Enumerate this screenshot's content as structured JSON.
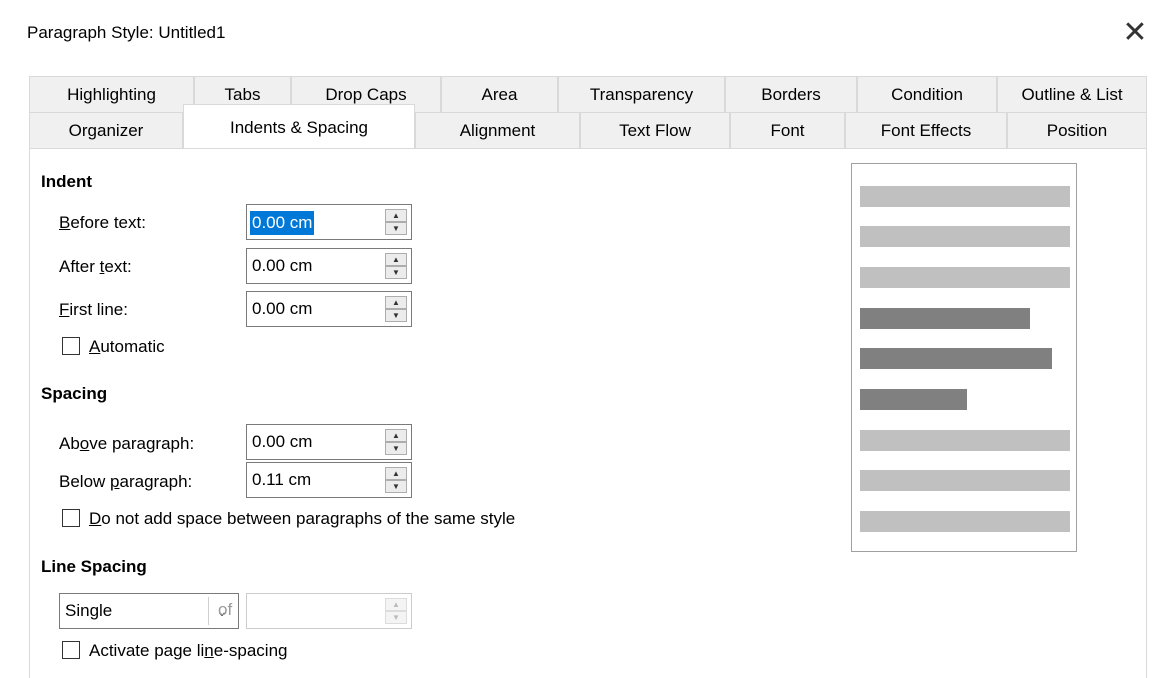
{
  "window": {
    "title": "Paragraph Style: Untitled1"
  },
  "tabs_row1": [
    "Highlighting",
    "Tabs",
    "Drop Caps",
    "Area",
    "Transparency",
    "Borders",
    "Condition",
    "Outline & List"
  ],
  "tabs_row2": [
    "Organizer",
    "Indents & Spacing",
    "Alignment",
    "Text Flow",
    "Font",
    "Font Effects",
    "Position"
  ],
  "active_tab": "Indents & Spacing",
  "indent": {
    "heading": "Indent",
    "before_text": {
      "label_pre": "",
      "label_key": "B",
      "label_post": "efore text:",
      "value": "0.00 cm"
    },
    "after_text": {
      "label_pre": "After ",
      "label_key": "t",
      "label_post": "ext:",
      "value": "0.00 cm"
    },
    "first_line": {
      "label_pre": "",
      "label_key": "F",
      "label_post": "irst line:",
      "value": "0.00 cm"
    },
    "automatic": {
      "label_pre": "",
      "label_key": "A",
      "label_post": "utomatic",
      "checked": false
    }
  },
  "spacing": {
    "heading": "Spacing",
    "above": {
      "label_pre": "Ab",
      "label_key": "o",
      "label_post": "ve paragraph:",
      "value": "0.00 cm"
    },
    "below": {
      "label_pre": "Below ",
      "label_key": "p",
      "label_post": "aragraph:",
      "value": "0.11 cm"
    },
    "no_space": {
      "label_pre": "",
      "label_key": "D",
      "label_post": "o not add space between paragraphs of the same style",
      "checked": false
    }
  },
  "line_spacing": {
    "heading": "Line Spacing",
    "selected": "Single",
    "of_label": "of",
    "of_value": "",
    "activate": {
      "label_pre": "Activate page li",
      "label_key": "n",
      "label_post": "e-spacing",
      "checked": false
    }
  },
  "colors": {
    "selection": "#0078d7",
    "preview_light": "#c0c0c0",
    "preview_dark": "#808080"
  },
  "icons": {
    "close": "close-icon",
    "spin_up": "spin-up-icon",
    "spin_down": "spin-down-icon",
    "dropdown": "chevron-down-icon"
  }
}
